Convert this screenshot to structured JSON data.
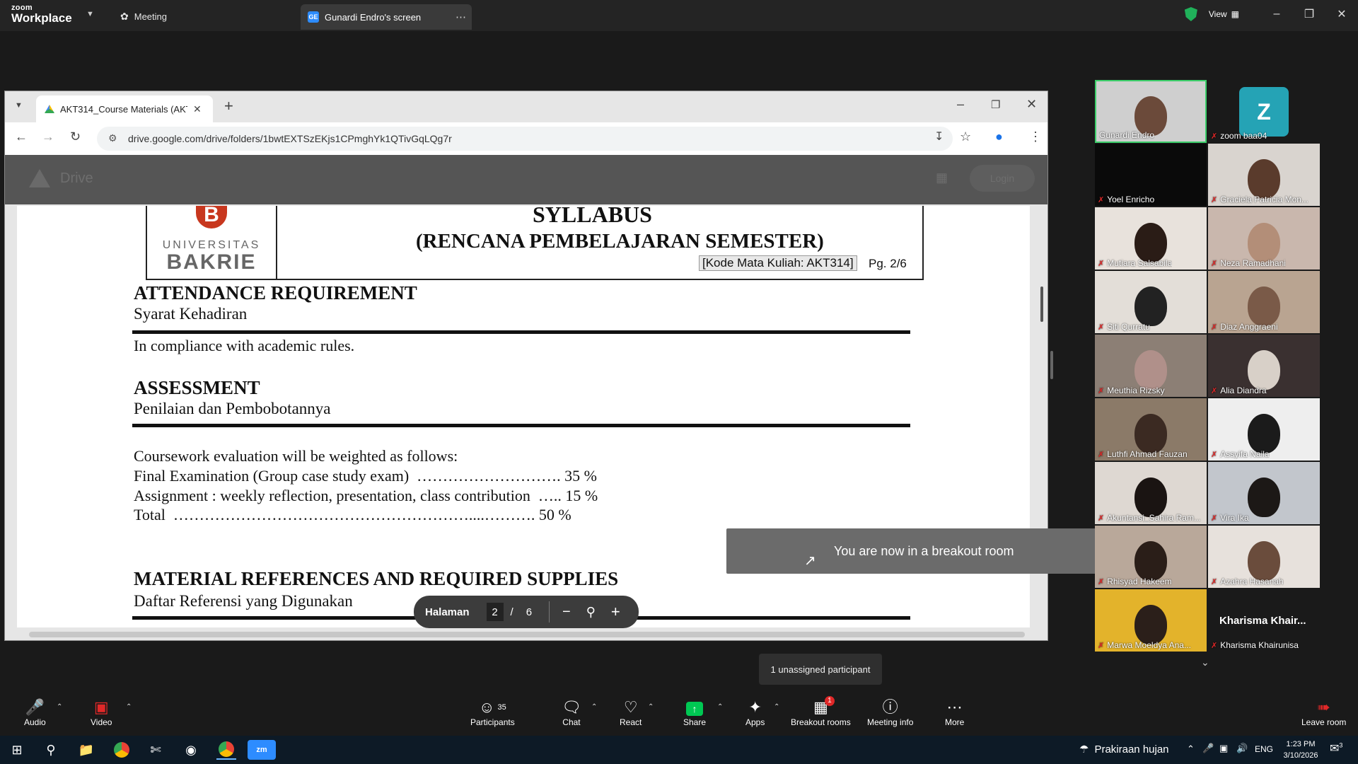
{
  "zoom": {
    "brand_line1": "zoom",
    "brand_line2": "Workplace",
    "meeting_tab": "Meeting",
    "screen_tab": "Gunardi Endro's screen",
    "screen_tab_initials": "GE",
    "view_label": "View"
  },
  "browser": {
    "tab_title": "AKT314_Course Materials (AKT)",
    "url": "drive.google.com/drive/folders/1bwtEXTSzEKjs1CPmghYk1QTivGqLQg7r",
    "drive_label": "Drive",
    "login_label": "Login"
  },
  "doc": {
    "logo_universitas": "UNIVERSITAS",
    "logo_bakrie": "BAKRIE",
    "logo_letter": "B",
    "title": "SYLLABUS",
    "subtitle": "(RENCANA PEMBELAJARAN SEMESTER)",
    "code": "[Kode Mata Kuliah: AKT314]",
    "page": "Pg. 2/6",
    "s1_head": "ATTENDANCE REQUIREMENT",
    "s1_sub": "Syarat Kehadiran",
    "s1_text": "In compliance with academic rules.",
    "s2_head": "ASSESSMENT",
    "s2_sub": "Penilaian dan Pembobotannya",
    "s2_l1": "Coursework evaluation will be weighted as follows:",
    "s2_l2": "Final Examination (Group case study exam)  ………………………. 35 %",
    "s2_l3": "Assignment : weekly reflection, presentation, class contribution  ….. 15 %",
    "s2_l4": "Total  …………………………………………………....………. 50 %",
    "s3_head": "MATERIAL REFERENCES AND REQUIRED SUPPLIES",
    "s3_sub": "Daftar Referensi yang Digunakan"
  },
  "page_control": {
    "label": "Halaman",
    "current": "2",
    "separator": "/",
    "total": "6"
  },
  "toast": "You are now in a breakout room",
  "unassigned": "1 unassigned participant",
  "participants": [
    {
      "name": "Gunardi Endro"
    },
    {
      "name": "zoom baa04",
      "initial": "Z"
    },
    {
      "name": "Yoel Enricho"
    },
    {
      "name": "Graciela Patricia Mon..."
    },
    {
      "name": "Mutiara Salsabila"
    },
    {
      "name": "Neza Ramadhani"
    },
    {
      "name": "Siti Qurratu"
    },
    {
      "name": "Diaz Anggraeni"
    },
    {
      "name": "Meuthia Rizsky"
    },
    {
      "name": "Alia Diandra"
    },
    {
      "name": "Luthfi Ahmad Fauzan"
    },
    {
      "name": "Assyifa Naila"
    },
    {
      "name": "Akuntansi_Sahira Ram..."
    },
    {
      "name": "Vira Ika"
    },
    {
      "name": "Rhisyad Hakeem"
    },
    {
      "name": "Azahra Hasanah"
    },
    {
      "name": "Marwa Moeldya Ana..."
    },
    {
      "name": "Kharisma Khairunisa",
      "display": "Kharisma  Khair..."
    }
  ],
  "toolbar": {
    "audio": "Audio",
    "video": "Video",
    "participants": "Participants",
    "participants_count": "35",
    "chat": "Chat",
    "react": "React",
    "share": "Share",
    "apps": "Apps",
    "breakout": "Breakout rooms",
    "breakout_badge": "1",
    "meeting_info": "Meeting info",
    "more": "More",
    "leave": "Leave room"
  },
  "taskbar": {
    "weather": "Prakiraan hujan",
    "lang": "ENG",
    "time": "1:23 PM",
    "date": "3/10/2026",
    "notif": "3"
  },
  "colors": {
    "zoom_bg": "#1a1a1a",
    "share_green": "#00c853",
    "mic_off": "#e02828",
    "active_border": "#3ccf6a",
    "breakout_badge": "#e02828"
  }
}
